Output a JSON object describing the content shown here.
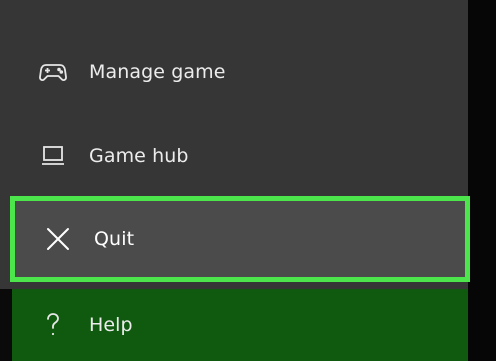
{
  "menu": {
    "items": [
      {
        "label": "Manage game",
        "icon": "gamepad-icon"
      },
      {
        "label": "Game hub",
        "icon": "monitor-icon"
      },
      {
        "label": "Quit",
        "icon": "close-icon",
        "selected": true
      },
      {
        "label": "Help",
        "icon": "question-icon"
      }
    ]
  },
  "colors": {
    "panel": "#363636",
    "selected_bg": "#4b4b4b",
    "focus_border": "#4ce64c",
    "help_bg": "#0f5a0f",
    "text": "#ececec"
  }
}
